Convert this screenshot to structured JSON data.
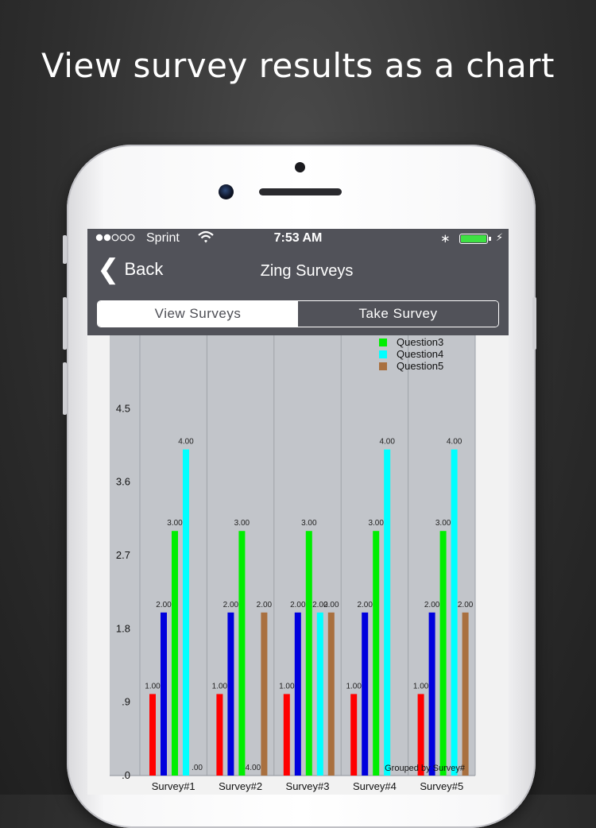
{
  "headline": "View survey results as a chart",
  "status": {
    "carrier": "Sprint",
    "time": "7:53 AM",
    "signal_icon": "signal-dots-icon",
    "wifi_icon": "wifi-icon",
    "bluetooth_icon": "bluetooth-icon",
    "battery_level": 1.0
  },
  "nav": {
    "back_label": "Back",
    "title": "Zing Surveys"
  },
  "tabs": {
    "view": "View Surveys",
    "take": "Take Survey",
    "selected": "View Surveys"
  },
  "colors": {
    "q1": "#ff0000",
    "q2": "#0000dd",
    "q3": "#00ee00",
    "q4": "#00ffff",
    "q5": "#a9703f",
    "plot_bg": "#c2c5ca",
    "bar_bg": "#515259"
  },
  "chart_data": {
    "type": "bar",
    "categories": [
      "Survey#1",
      "Survey#2",
      "Survey#3",
      "Survey#4",
      "Survey#5"
    ],
    "series": [
      {
        "key": "q1",
        "values": [
          1,
          1,
          1,
          1,
          1
        ]
      },
      {
        "key": "q2",
        "values": [
          2,
          2,
          2,
          2,
          2
        ]
      },
      {
        "name": "Question3",
        "key": "q3",
        "values": [
          3,
          3,
          3,
          3,
          3
        ]
      },
      {
        "name": "Question4",
        "key": "q4",
        "values": [
          4,
          0,
          2,
          4,
          4
        ]
      },
      {
        "name": "Question5",
        "key": "q5",
        "values": [
          0,
          2,
          2,
          0,
          2
        ]
      }
    ],
    "data_labels": [
      [
        "1.00",
        "2.00",
        "3.00",
        "4.00",
        ".00"
      ],
      [
        "1.00",
        "2.00",
        "3.00",
        "4.00",
        "2.00"
      ],
      [
        "1.00",
        "2.00",
        "3.00",
        "2.00",
        "2.00"
      ],
      [
        "1.00",
        "2.00",
        "3.00",
        "4.00",
        ""
      ],
      [
        "1.00",
        "2.00",
        "3.00",
        "4.00",
        "2.00"
      ]
    ],
    "y_ticks": [
      ".0",
      ".9",
      "1.8",
      "2.7",
      "3.6",
      "4.5"
    ],
    "y_tick_values": [
      0,
      0.9,
      1.8,
      2.7,
      3.6,
      4.5
    ],
    "ylim": [
      0,
      5.4
    ],
    "annotation": "Grouped by Survey#",
    "legend_placement": "top-right",
    "grid": true
  }
}
